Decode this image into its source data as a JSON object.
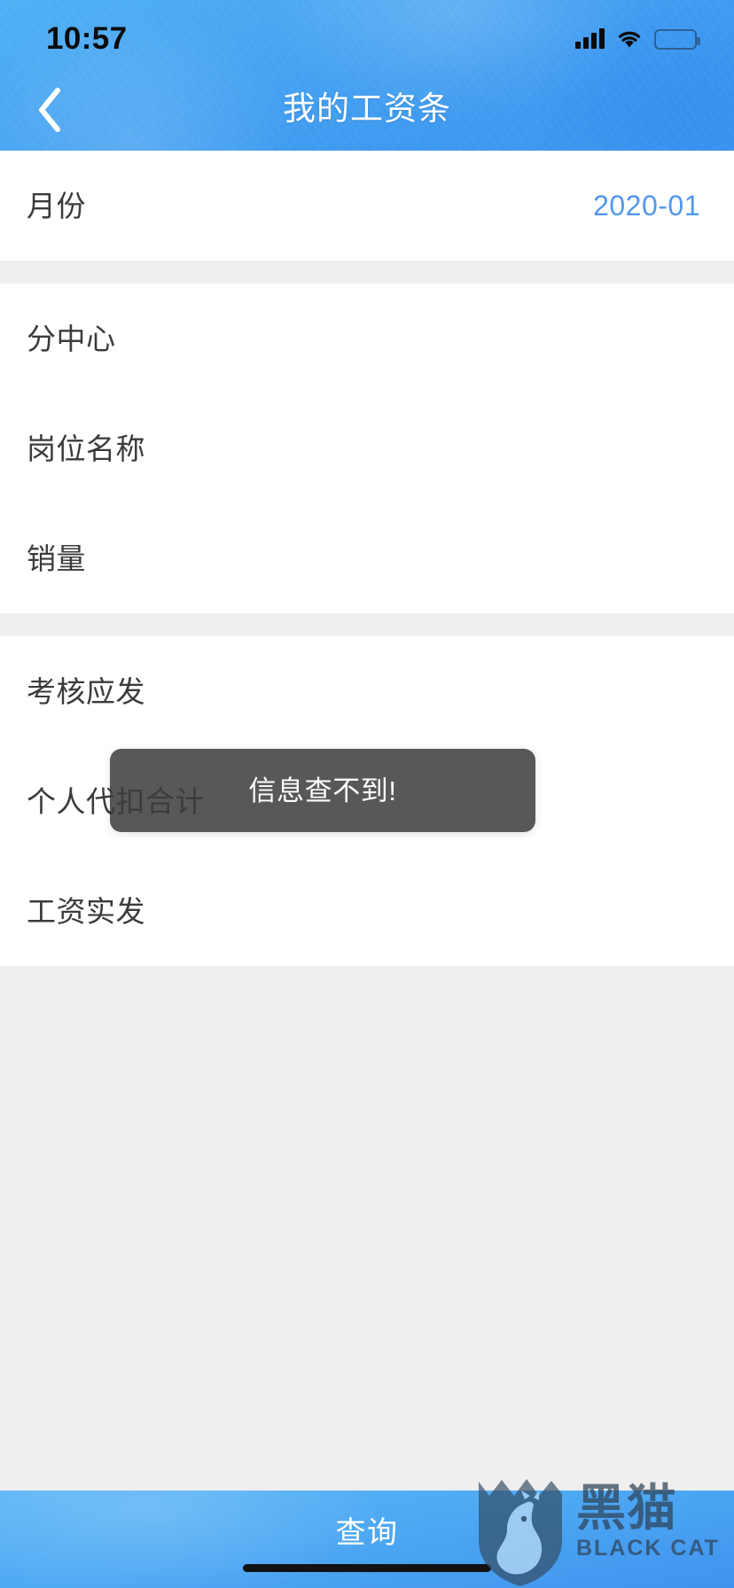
{
  "statusbar": {
    "time": "10:57",
    "signal_icon": "signal-bars-icon",
    "wifi_icon": "wifi-icon",
    "battery_icon": "battery-low-icon",
    "battery_percent": 11
  },
  "navbar": {
    "back_icon": "chevron-left-icon",
    "title": "我的工资条"
  },
  "sections": [
    {
      "rows": [
        {
          "label": "月份",
          "value": "2020-01",
          "value_style": "accent"
        }
      ]
    },
    {
      "rows": [
        {
          "label": "分中心",
          "value": "",
          "value_style": "empty"
        },
        {
          "label": "岗位名称",
          "value": "",
          "value_style": "empty"
        },
        {
          "label": "销量",
          "value": "",
          "value_style": "empty"
        }
      ]
    },
    {
      "rows": [
        {
          "label": "考核应发",
          "value": "",
          "value_style": "empty"
        },
        {
          "label": "个人代扣合计",
          "value": "",
          "value_style": "empty"
        },
        {
          "label": "工资实发",
          "value": "",
          "value_style": "empty"
        }
      ]
    }
  ],
  "toast": {
    "message": "信息查不到!"
  },
  "bottombar": {
    "query_label": "查询"
  },
  "watermark": {
    "logo_icon": "black-cat-shield-icon",
    "cn_text": "黑猫",
    "en_text": "BLACK CAT"
  },
  "colors": {
    "header_blue": "#4aa7f2",
    "accent_blue": "#5398ec",
    "label_gray": "#3b3b3b",
    "page_bg": "#efefef",
    "toast_bg": "rgba(60,60,60,0.86)",
    "battery_red": "#f2342c"
  }
}
